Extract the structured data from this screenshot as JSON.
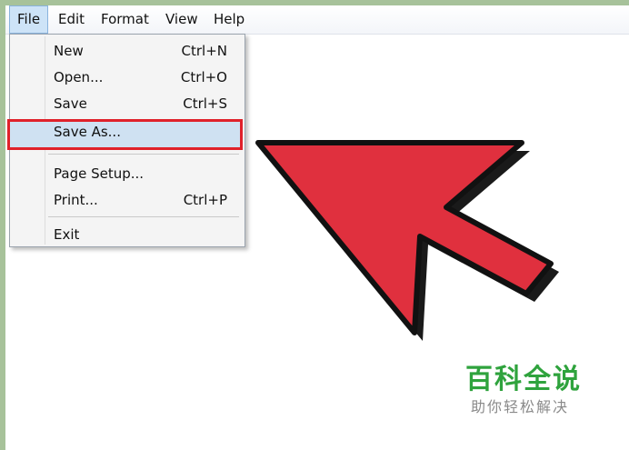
{
  "menubar": {
    "items": [
      "File",
      "Edit",
      "Format",
      "View",
      "Help"
    ]
  },
  "file_menu": {
    "new": {
      "label": "New",
      "shortcut": "Ctrl+N"
    },
    "open": {
      "label": "Open...",
      "shortcut": "Ctrl+O"
    },
    "save": {
      "label": "Save",
      "shortcut": "Ctrl+S"
    },
    "save_as": {
      "label": "Save As..."
    },
    "page_setup": {
      "label": "Page Setup..."
    },
    "print": {
      "label": "Print...",
      "shortcut": "Ctrl+P"
    },
    "exit": {
      "label": "Exit"
    }
  },
  "annotation": {
    "highlight_color": "#e0212a",
    "arrow_color": "#e0303e",
    "arrow_points_to": "Save As..."
  },
  "watermark": {
    "title": "百科全说",
    "subtitle": "助你轻松解决"
  }
}
